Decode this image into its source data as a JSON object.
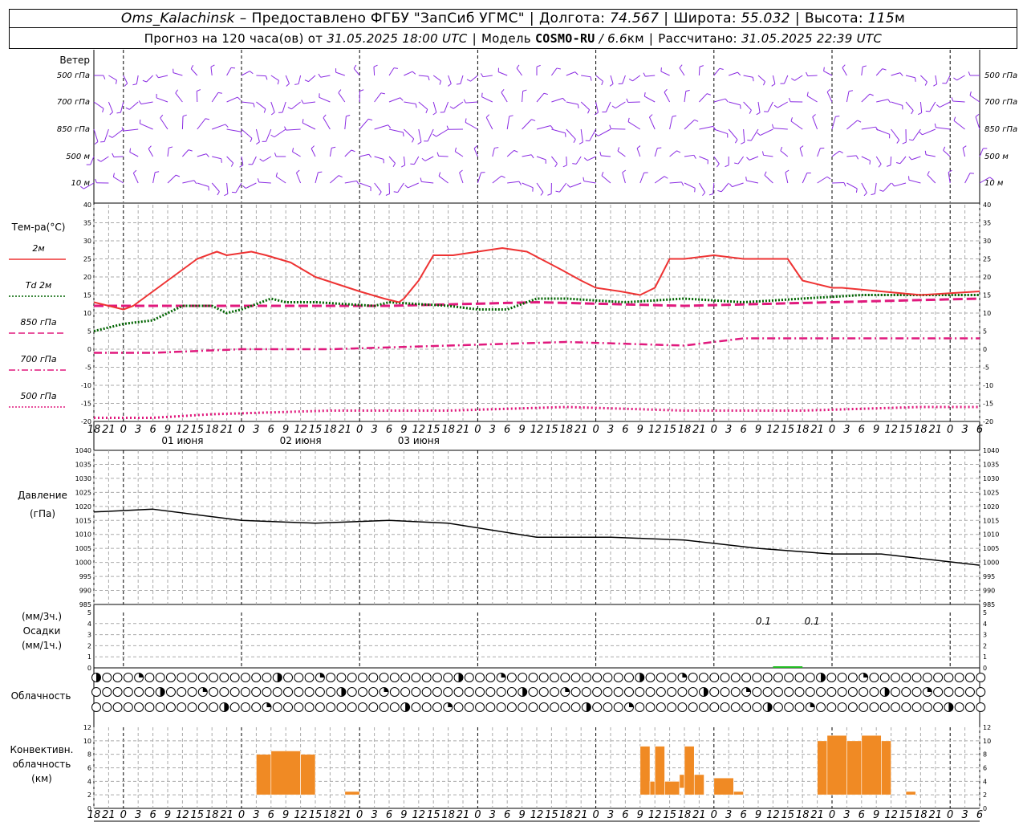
{
  "header": {
    "station": "Oms_Kalachinsk",
    "dash": "–",
    "provider": "Предоставлено ФГБУ \"ЗапСиб УГМС\"",
    "lon_label": "Долгота:",
    "lon_value": "74.567",
    "lat_label": "Широта:",
    "lat_value": "55.032",
    "alt_label": "Высота:",
    "alt_value": "115",
    "alt_unit": "м",
    "forecast_prefix": "Прогноз на 120 часа(ов) от",
    "forecast_start": "31.05.2025 18:00 UTC",
    "model_label": "Модель",
    "model_name": "COSMO-RU",
    "model_res": "/ 6.6",
    "model_res_unit": "км",
    "computed_label": "Рассчитано:",
    "computed_time": "31.05.2025 22:39 UTC"
  },
  "time_axis": {
    "tick_labels": [
      "18",
      "21",
      "0",
      "3",
      "6",
      "9",
      "12",
      "15",
      "18",
      "21",
      "0",
      "3",
      "6",
      "9",
      "12",
      "15",
      "18",
      "21",
      "0",
      "3",
      "6",
      "9",
      "12",
      "15",
      "18",
      "21",
      "0"
    ],
    "date_labels": [
      "01 июня",
      "02 июня",
      "03 июня"
    ]
  },
  "wind_panel": {
    "title": "Ветер",
    "levels": [
      "500 гПа",
      "700 гПа",
      "850 гПа",
      "500 м",
      "10  м"
    ],
    "barb_color": "#8a2be2"
  },
  "temp_panel": {
    "title": "Тем-ра(°С)",
    "legend": [
      {
        "label": "2м",
        "color": "#ee3333",
        "style": "solid"
      },
      {
        "label": "Td  2м",
        "color": "#006400",
        "style": "dotted"
      },
      {
        "label": "850 гПа",
        "color": "#e0197d",
        "style": "dashed"
      },
      {
        "label": "700 гПа",
        "color": "#e0197d",
        "style": "dashdot"
      },
      {
        "label": "500 гПа",
        "color": "#e0197d",
        "style": "dotted"
      }
    ],
    "y_ticks": [
      "40",
      "35",
      "30",
      "25",
      "20",
      "15",
      "10",
      "5",
      "0",
      "-5",
      "-10",
      "-15",
      "-20"
    ]
  },
  "pressure_panel": {
    "title": "Давление",
    "unit": "(гПа)",
    "y_ticks": [
      "1040",
      "1035",
      "1030",
      "1025",
      "1020",
      "1015",
      "1010",
      "1005",
      "1000",
      "995",
      "990",
      "985"
    ]
  },
  "precip_panel": {
    "unit3": "(мм/3ч.)",
    "title": "Осадки",
    "unit1": "(мм/1ч.)",
    "y_ticks": [
      "5",
      "4",
      "3",
      "2",
      "1",
      "0"
    ],
    "annotations": [
      "0.1",
      "0.1"
    ],
    "bar_color": "#22bb22"
  },
  "cloud_panel": {
    "title": "Облачность"
  },
  "conv_panel": {
    "title": [
      "Конвективн.",
      "облачность",
      "(км)"
    ],
    "y_ticks": [
      "12",
      "10",
      "8",
      "6",
      "4",
      "2",
      "0"
    ],
    "bar_color": "#f08a24"
  },
  "chart_data": {
    "type": "line",
    "x_hours_from_start": "0..120 (3-hourly ticks, start 31.05.2025 18:00 UTC)",
    "t2m": {
      "x": [
        0,
        6,
        8,
        14,
        21,
        25,
        27,
        32,
        35,
        40,
        45,
        54,
        59,
        62,
        63,
        66,
        69,
        73,
        78,
        83,
        88,
        95,
        99,
        102,
        107,
        111,
        114,
        117,
        120,
        126,
        132,
        141,
        144,
        150,
        152,
        160,
        168,
        180
      ],
      "y": [
        13,
        11,
        12,
        18,
        25,
        27,
        26,
        27,
        26,
        24,
        20,
        16,
        14,
        13,
        14,
        19,
        26,
        26,
        27,
        28,
        27,
        22,
        19,
        17,
        16,
        15,
        17,
        25,
        25,
        26,
        25,
        25,
        19,
        17,
        17,
        16,
        15,
        16
      ]
    },
    "td2m": {
      "x": [
        0,
        6,
        12,
        18,
        24,
        27,
        30,
        36,
        39,
        45,
        57,
        60,
        72,
        78,
        84,
        90,
        96,
        108,
        120,
        132,
        144,
        156,
        168,
        180
      ],
      "y": [
        5,
        7,
        8,
        12,
        12,
        10,
        11,
        14,
        13,
        13,
        12,
        13,
        12,
        11,
        11,
        14,
        14,
        13,
        14,
        13,
        14,
        15,
        15,
        15
      ]
    },
    "t850": {
      "x": [
        0,
        30,
        60,
        90,
        120,
        150,
        180
      ],
      "y": [
        12,
        12,
        12,
        13,
        12,
        13,
        14
      ]
    },
    "t700": {
      "x": [
        0,
        12,
        30,
        48,
        72,
        96,
        120,
        132,
        150,
        180
      ],
      "y": [
        -1,
        -1,
        0,
        0,
        1,
        2,
        1,
        3,
        3,
        3
      ]
    },
    "t500": {
      "x": [
        0,
        12,
        24,
        48,
        72,
        96,
        120,
        144,
        168,
        180
      ],
      "y": [
        -19,
        -19,
        -18,
        -17,
        -17,
        -16,
        -17,
        -17,
        -16,
        -16
      ]
    },
    "pressure": {
      "x": [
        0,
        12,
        30,
        45,
        60,
        72,
        90,
        105,
        120,
        135,
        150,
        160,
        170,
        180
      ],
      "y": [
        1018,
        1019,
        1015,
        1014,
        1015,
        1014,
        1009,
        1009,
        1008,
        1005,
        1003,
        1003,
        1001,
        999
      ]
    },
    "precip": {
      "x": [
        138,
        144
      ],
      "y": [
        0.1,
        0.1
      ]
    },
    "conv_cloud_km": [
      {
        "from": 33,
        "to": 36,
        "bottom": 2,
        "top": 8
      },
      {
        "from": 36,
        "to": 42,
        "bottom": 2,
        "top": 8.5
      },
      {
        "from": 42,
        "to": 45,
        "bottom": 2,
        "top": 8
      },
      {
        "from": 51,
        "to": 54,
        "bottom": 2,
        "top": 2.5
      },
      {
        "from": 111,
        "to": 113,
        "bottom": 2,
        "top": 9.2
      },
      {
        "from": 113,
        "to": 114,
        "bottom": 2,
        "top": 4
      },
      {
        "from": 114,
        "to": 116,
        "bottom": 2,
        "top": 9.2
      },
      {
        "from": 116,
        "to": 119,
        "bottom": 2,
        "top": 4
      },
      {
        "from": 119,
        "to": 120,
        "bottom": 3,
        "top": 5
      },
      {
        "from": 120,
        "to": 122,
        "bottom": 2,
        "top": 9.2
      },
      {
        "from": 122,
        "to": 124,
        "bottom": 2,
        "top": 5
      },
      {
        "from": 126,
        "to": 130,
        "bottom": 2,
        "top": 4.5
      },
      {
        "from": 130,
        "to": 132,
        "bottom": 2,
        "top": 2.5
      },
      {
        "from": 147,
        "to": 149,
        "bottom": 2,
        "top": 10
      },
      {
        "from": 149,
        "to": 153,
        "bottom": 2,
        "top": 10.8
      },
      {
        "from": 153,
        "to": 156,
        "bottom": 2,
        "top": 10
      },
      {
        "from": 156,
        "to": 160,
        "bottom": 2,
        "top": 10.8
      },
      {
        "from": 160,
        "to": 162,
        "bottom": 2,
        "top": 10
      },
      {
        "from": 165,
        "to": 167,
        "bottom": 2,
        "top": 2.5
      }
    ]
  }
}
